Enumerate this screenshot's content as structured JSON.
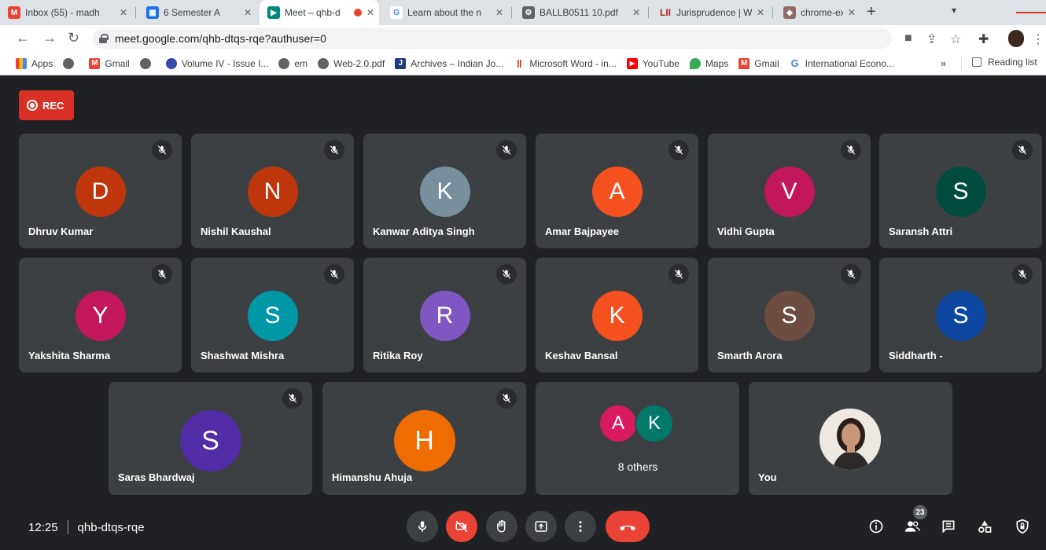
{
  "browser": {
    "tabs": [
      {
        "title": "Inbox (55) - madh",
        "favicon": "gmail-icon",
        "color": "#ea4335",
        "active": false
      },
      {
        "title": "6 Semester A",
        "favicon": "classroom-icon",
        "color": "#1a73e8",
        "active": false
      },
      {
        "title": "Meet – qhb-d",
        "favicon": "meet-icon",
        "color": "#00897b",
        "active": true
      },
      {
        "title": "Learn about the n",
        "favicon": "google-icon",
        "color": "#4285f4",
        "active": false
      },
      {
        "title": "BALLB0511 10.pdf",
        "favicon": "pdf-icon",
        "color": "#5f6368",
        "active": false
      },
      {
        "title": "Jurisprudence | W",
        "favicon": "lii-icon",
        "color": "#b3261e",
        "active": false
      },
      {
        "title": "chrome-extension",
        "favicon": "extension-icon",
        "color": "#8d6e63",
        "active": false
      }
    ],
    "url": "meet.google.com/qhb-dtqs-rqe?authuser=0",
    "bookmarks": [
      {
        "label": "Apps",
        "icon": "apps-grid-icon",
        "color": "#ea4335"
      },
      {
        "label": "",
        "icon": "globe-icon",
        "color": "#5f6368"
      },
      {
        "label": "Gmail",
        "icon": "gmail-icon",
        "color": "#ea4335"
      },
      {
        "label": "",
        "icon": "globe-icon",
        "color": "#5f6368"
      },
      {
        "label": "Volume IV - Issue I...",
        "icon": "site-icon",
        "color": "#3949ab"
      },
      {
        "label": "em",
        "icon": "globe-icon",
        "color": "#5f6368"
      },
      {
        "label": "Web-2.0.pdf",
        "icon": "globe-icon",
        "color": "#5f6368"
      },
      {
        "label": "Archives – Indian Jo...",
        "icon": "journal-icon",
        "color": "#1a3d7c"
      },
      {
        "label": "Microsoft Word - in...",
        "icon": "word-icon",
        "color": "#d93025"
      },
      {
        "label": "YouTube",
        "icon": "youtube-icon",
        "color": "#ff0000"
      },
      {
        "label": "Maps",
        "icon": "maps-icon",
        "color": "#34a853"
      },
      {
        "label": "Gmail",
        "icon": "gmail-icon",
        "color": "#ea4335"
      },
      {
        "label": "International Econo...",
        "icon": "google-icon",
        "color": "#4285f4"
      }
    ],
    "more_bookmarks": "»",
    "reading_list": "Reading list"
  },
  "meet": {
    "rec_label": "REC",
    "participants": [
      {
        "name": "Dhruv Kumar",
        "initial": "D",
        "color": "#bf360c",
        "muted": true
      },
      {
        "name": "Nishil Kaushal",
        "initial": "N",
        "color": "#bf360c",
        "muted": true
      },
      {
        "name": "Kanwar Aditya Singh",
        "initial": "K",
        "color": "#78909c",
        "muted": true
      },
      {
        "name": "Amar Bajpayee",
        "initial": "A",
        "color": "#f4511e",
        "muted": true
      },
      {
        "name": "Vidhi Gupta",
        "initial": "V",
        "color": "#c2185b",
        "muted": true
      },
      {
        "name": "Saransh Attri",
        "initial": "S",
        "color": "#004d40",
        "muted": true
      },
      {
        "name": "Yakshita Sharma",
        "initial": "Y",
        "color": "#c2185b",
        "muted": true
      },
      {
        "name": "Shashwat Mishra",
        "initial": "S",
        "color": "#0097a7",
        "muted": true
      },
      {
        "name": "Ritika Roy",
        "initial": "R",
        "color": "#7e57c2",
        "muted": true
      },
      {
        "name": "Keshav Bansal",
        "initial": "K",
        "color": "#f4511e",
        "muted": true
      },
      {
        "name": "Smarth Arora",
        "initial": "S",
        "color": "#6d4c41",
        "muted": true
      },
      {
        "name": "Siddharth -",
        "initial": "S",
        "color": "#0d47a1",
        "muted": true
      },
      {
        "name": "Saras Bhardwaj",
        "initial": "S",
        "color": "#512da8",
        "muted": true
      },
      {
        "name": "Himanshu Ahuja",
        "initial": "H",
        "color": "#ef6c00",
        "muted": true
      }
    ],
    "others": {
      "label": "8 others",
      "avatars": [
        {
          "initial": "A",
          "color": "#d81b60"
        },
        {
          "initial": "K",
          "color": "#00796b"
        }
      ]
    },
    "self": {
      "name": "You"
    },
    "bottom_bar": {
      "time": "12:25",
      "meeting_code": "qhb-dtqs-rqe",
      "people_count": "23",
      "controls": [
        "microphone-icon",
        "camera-off-icon",
        "raise-hand-icon",
        "present-screen-icon",
        "more-options-icon",
        "end-call-icon"
      ],
      "right_controls": [
        "meeting-info-icon",
        "people-icon",
        "chat-icon",
        "activities-icon",
        "host-controls-icon"
      ]
    }
  }
}
